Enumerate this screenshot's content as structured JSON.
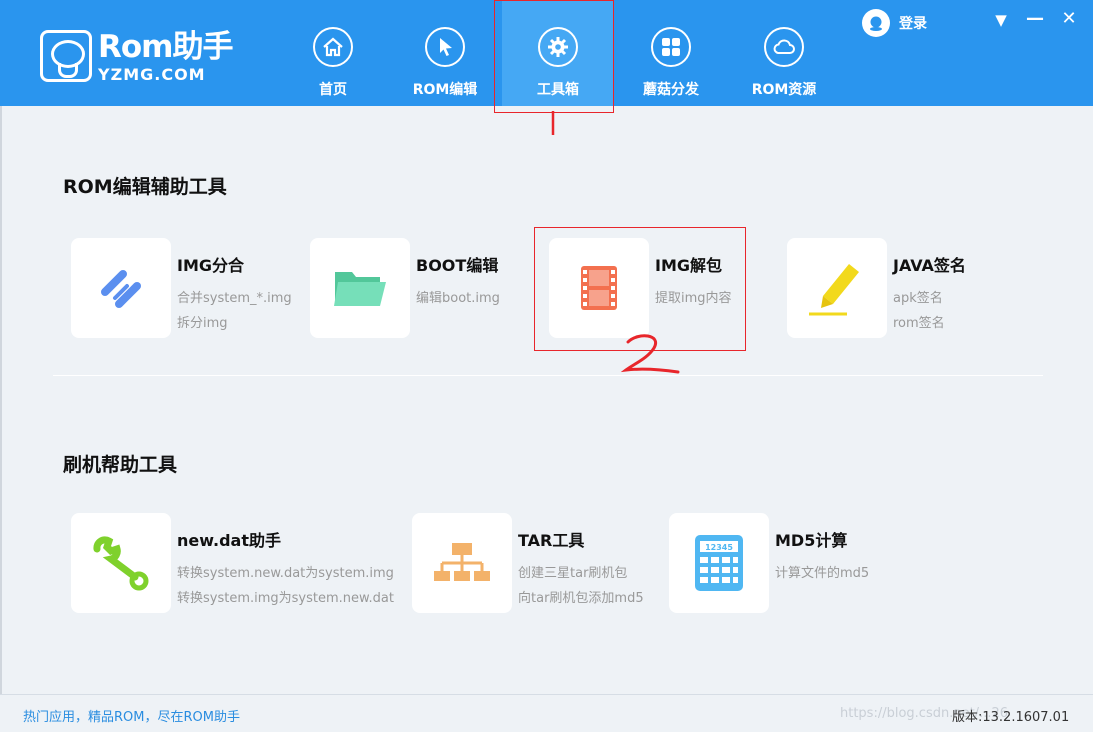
{
  "header": {
    "logo_name": "Rom助手",
    "logo_sub": "YZMG.COM",
    "nav": [
      {
        "label": "首页",
        "icon": "home-icon"
      },
      {
        "label": "ROM编辑",
        "icon": "cursor-arrow-icon"
      },
      {
        "label": "工具箱",
        "icon": "gear-icon"
      },
      {
        "label": "蘑菇分发",
        "icon": "grid-apps-icon"
      },
      {
        "label": "ROM资源",
        "icon": "cloud-icon"
      }
    ],
    "active_nav": "工具箱",
    "login_label": "登录",
    "controls": {
      "dropdown": "▼",
      "minimize": "—",
      "close": "✕"
    }
  },
  "annotations": {
    "mark_1": "1",
    "mark_2": "2"
  },
  "sections": [
    {
      "title": "ROM编辑辅助工具",
      "tools": [
        {
          "title": "IMG分合",
          "desc": [
            "合并system_*.img",
            "拆分img"
          ],
          "icon": "chain-link-icon",
          "color": "#5b8fef"
        },
        {
          "title": "BOOT编辑",
          "desc": [
            "编辑boot.img"
          ],
          "icon": "folder-icon",
          "color": "#6fd9b2"
        },
        {
          "title": "IMG解包",
          "desc": [
            "提取img内容"
          ],
          "icon": "film-strip-icon",
          "color": "#f3704f"
        },
        {
          "title": "JAVA签名",
          "desc": [
            "apk签名",
            "rom签名"
          ],
          "icon": "pen-icon",
          "color": "#f2d91c"
        }
      ]
    },
    {
      "title": "刷机帮助工具",
      "tools": [
        {
          "title": "new.dat助手",
          "desc": [
            "转换system.new.dat为system.img",
            "转换system.img为system.new.dat"
          ],
          "icon": "wrench-icon",
          "color": "#7fd12c"
        },
        {
          "title": "TAR工具",
          "desc": [
            "创建三星tar刷机包",
            "向tar刷机包添加md5"
          ],
          "icon": "hierarchy-icon",
          "color": "#f3b26a"
        },
        {
          "title": "MD5计算",
          "desc": [
            "计算文件的md5"
          ],
          "icon": "calculator-icon",
          "color": "#4fb7f2",
          "icon_text": "12345"
        }
      ]
    }
  ],
  "footer": {
    "slogan": "热门应用，精品ROM，尽在ROM助手",
    "watermark": "https://blog.csdn.net/...26",
    "version": "版本:13.2.1607.01"
  }
}
